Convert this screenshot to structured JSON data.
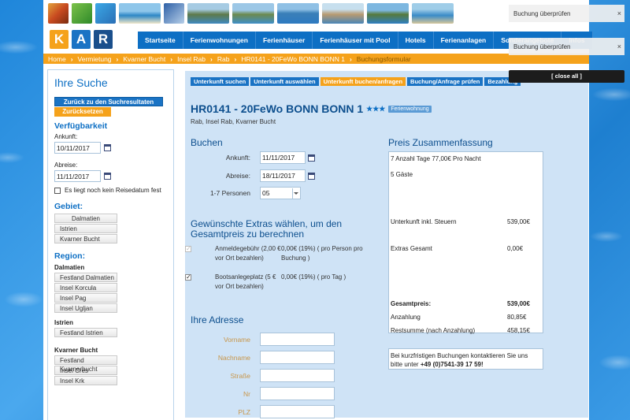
{
  "nav": {
    "items": [
      "Startseite",
      "Ferienwohnungen",
      "Ferienhäuser",
      "Ferienhäuser mit Pool",
      "Hotels",
      "Ferienanlagen",
      "Sonderangebote",
      "Infos"
    ]
  },
  "logo": {
    "letters": [
      "K",
      "A",
      "R"
    ]
  },
  "breadcrumb": [
    "Home",
    "Vermietung",
    "Kvarner Bucht",
    "Insel Rab",
    "Rab",
    "HR0141 - 20FeWo BONN BONN 1",
    "Buchungsformular"
  ],
  "sidebar": {
    "title": "Ihre Suche",
    "back_button": "Zurück zu den Suchresultaten",
    "reset_button": "Zurücksetzen",
    "availability_heading": "Verfügbarkeit",
    "arrival_label": "Ankunft:",
    "arrival_value": "10/11/2017",
    "departure_label": "Abreise:",
    "departure_value": "11/11/2017",
    "no_date_label": "Es liegt noch kein Reisedatum fest",
    "area_heading": "Gebiet:",
    "areas": [
      "Dalmatien",
      "Istrien",
      "Kvarner Bucht"
    ],
    "region_heading": "Region:",
    "group_dalmatien": "Dalmatien",
    "regions_dalmatien": [
      "Festland Dalmatien",
      "Insel Korcula",
      "Insel Pag",
      "Insel Ugljan"
    ],
    "group_istrien": "Istrien",
    "regions_istrien": [
      "Festland Istrien"
    ],
    "group_kvarner": "Kvarner Bucht",
    "regions_kvarner": [
      "Festland Kvarnerbucht",
      "Insel Cres",
      "Insel Krk"
    ]
  },
  "steps": [
    "Unterkunft suchen",
    "Unterkunft auswählen",
    "Unterkunft buchen/anfragen",
    "Buchung/Anfrage prüfen",
    "Bezahlung"
  ],
  "property": {
    "title": "HR0141 - 20FeWo BONN BONN 1",
    "stars": "★★★",
    "badge": "Ferienwohnung",
    "location": "Rab, Insel Rab, Kvarner Bucht"
  },
  "booking": {
    "heading": "Buchen",
    "arrival_label": "Ankunft:",
    "arrival_value": "11/11/2017",
    "departure_label": "Abreise:",
    "departure_value": "18/11/2017",
    "persons_label": "1-7 Personen",
    "persons_value": "05"
  },
  "extras": {
    "heading": "Gewünschte Extras wählen, um den Gesamtpreis zu berechnen",
    "items": [
      {
        "name": "Anmeldegebühr (2,00 € vor Ort bezahlen)",
        "price": "0,00€ (19%) ( pro Person pro Buchung )"
      },
      {
        "name": "Bootsanlegeplatz (5 € vor Ort bezahlen)",
        "price": "0,00€ (19%) ( pro Tag )"
      }
    ]
  },
  "address": {
    "heading": "Ihre Adresse",
    "fields": [
      "Vorname",
      "Nachname",
      "Straße",
      "Nr",
      "PLZ"
    ]
  },
  "summary": {
    "heading": "Preis Zusammenfassung",
    "line1": "7 Anzahl Tage 77,00€ Pro Nacht",
    "line2": "5 Gäste",
    "accommodation_label": "Unterkunft inkl. Steuern",
    "accommodation_value": "539,00€",
    "extras_label": "Extras Gesamt",
    "extras_value": "0,00€",
    "total_label": "Gesamtpreis:",
    "total_value": "539,00€",
    "deposit_label": "Anzahlung",
    "deposit_value": "80,85€",
    "rest_label": "Restsumme (nach Anzahlung)",
    "rest_value": "458,15€",
    "contact_text": "Bei kurzfristigen Buchungen kontaktieren Sie uns bitte unter",
    "contact_phone": "+49 (0)7541-39 17 59!"
  },
  "notifications": {
    "items": [
      "Buchung überprüfen",
      "Buchung überprüfen"
    ],
    "close_all": "[ close all ]",
    "close_glyph": "×"
  },
  "colors": {
    "primary": "#0d6fc4",
    "accent": "#f5a21b",
    "logo_k": "#f5a21b",
    "logo_a": "#1a73c4",
    "logo_r": "#1a4f8c"
  }
}
